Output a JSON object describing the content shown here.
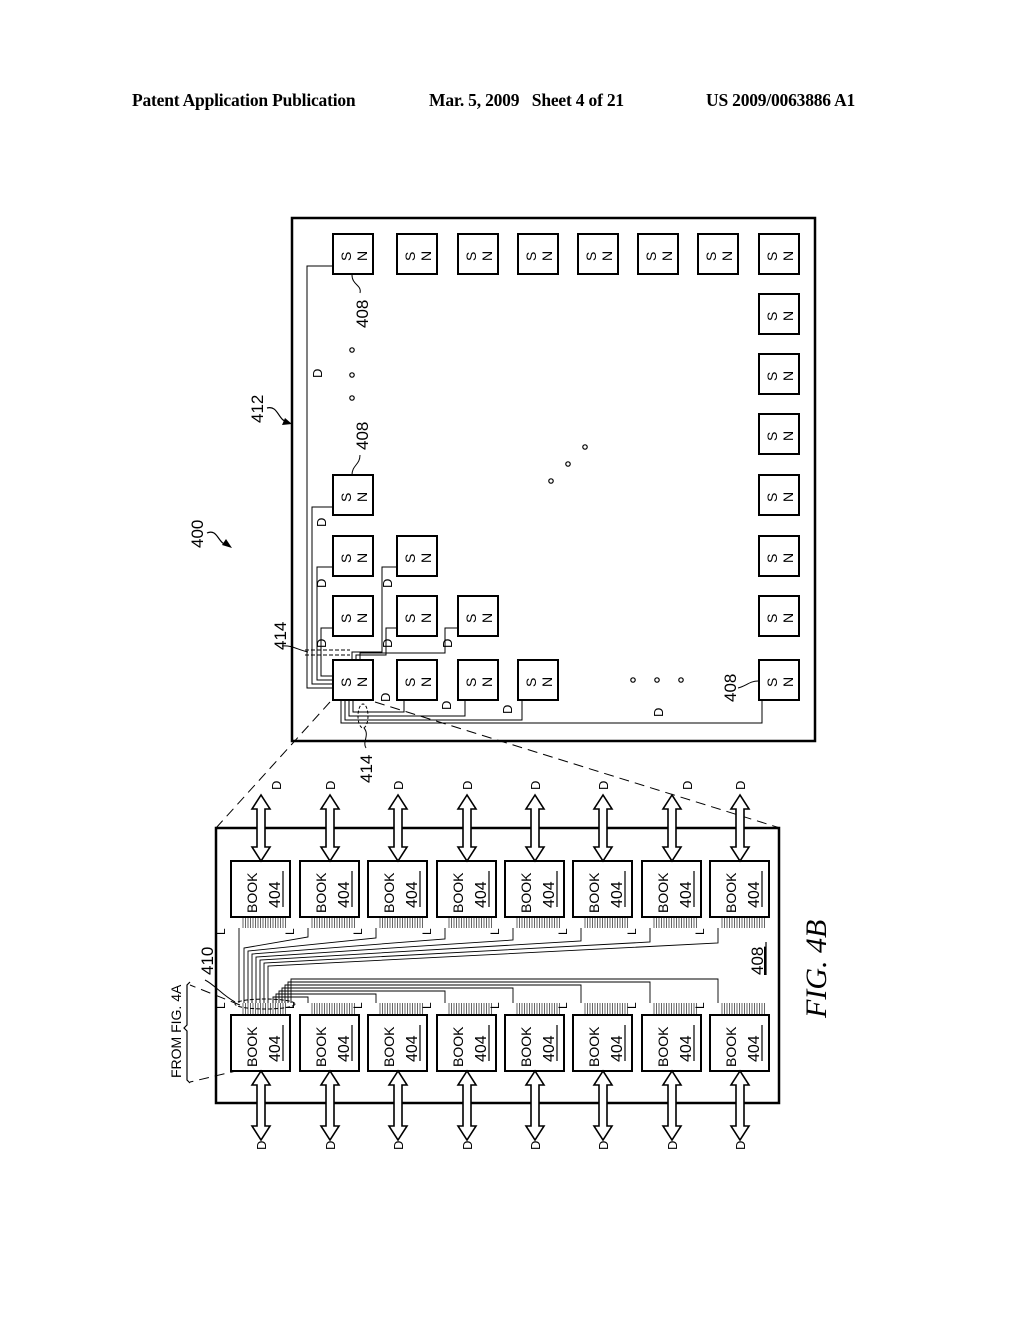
{
  "header": {
    "publication_type": "Patent Application Publication",
    "date_sheet": "Mar. 5, 2009   Sheet 4 of 21",
    "publication_number": "US 2009/0063886 A1"
  },
  "figure": {
    "caption": "FIG. 4B",
    "system_ref": "400",
    "upper_panel": {
      "board_ref": "412",
      "node_ref": "408",
      "cable_ref": "414",
      "node_pole_labels": [
        "S",
        "N"
      ],
      "link_label": "D",
      "node_grid": {
        "top_row_count": 8,
        "right_column_count": 8,
        "corner_cluster_rows": [
          4,
          3,
          2,
          1
        ]
      },
      "ellipsis": "∘ ∘ ∘"
    },
    "lower_panel": {
      "node_ref": "408",
      "bus_ref": "410",
      "source_note": "FROM FIG. 4A",
      "book_label": "BOOK",
      "book_ref": "404",
      "books_per_row": 8,
      "external_link_label": "D",
      "local_link_label": "L"
    }
  }
}
